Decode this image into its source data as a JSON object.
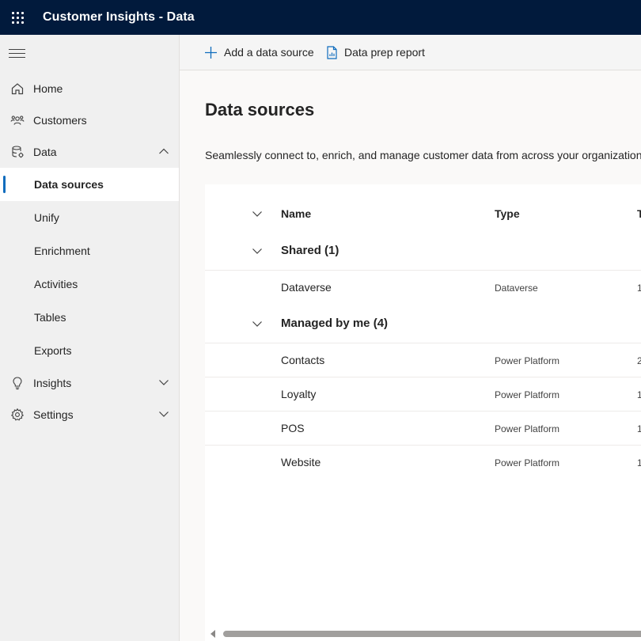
{
  "header": {
    "app_title": "Customer Insights - Data",
    "waffle_icon": "waffle-icon"
  },
  "sidebar": {
    "items": [
      {
        "label": "Home",
        "icon": "home-icon"
      },
      {
        "label": "Customers",
        "icon": "people-icon"
      },
      {
        "label": "Data",
        "icon": "database-icon",
        "expanded": true
      },
      {
        "label": "Insights",
        "icon": "lightbulb-icon",
        "expanded": false
      },
      {
        "label": "Settings",
        "icon": "gear-icon",
        "expanded": false
      }
    ],
    "data_subitems": [
      {
        "label": "Data sources",
        "selected": true
      },
      {
        "label": "Unify"
      },
      {
        "label": "Enrichment"
      },
      {
        "label": "Activities"
      },
      {
        "label": "Tables"
      },
      {
        "label": "Exports"
      }
    ]
  },
  "commandbar": {
    "add_label": "Add a data source",
    "report_label": "Data prep report"
  },
  "main": {
    "title": "Data sources",
    "description": "Seamlessly connect to, enrich, and manage customer data from across your organization."
  },
  "table": {
    "columns": {
      "name": "Name",
      "type": "Type",
      "extra": "T"
    },
    "groups": [
      {
        "title": "Shared (1)",
        "rows": [
          {
            "name": "Dataverse",
            "type": "Dataverse",
            "extra": "1"
          }
        ]
      },
      {
        "title": "Managed by me (4)",
        "rows": [
          {
            "name": "Contacts",
            "type": "Power Platform",
            "extra": "2"
          },
          {
            "name": "Loyalty",
            "type": "Power Platform",
            "extra": "1"
          },
          {
            "name": "POS",
            "type": "Power Platform",
            "extra": "1"
          },
          {
            "name": "Website",
            "type": "Power Platform",
            "extra": "1"
          }
        ]
      }
    ]
  },
  "colors": {
    "header_bg": "#011a3c",
    "accent": "#0f6cbd"
  }
}
